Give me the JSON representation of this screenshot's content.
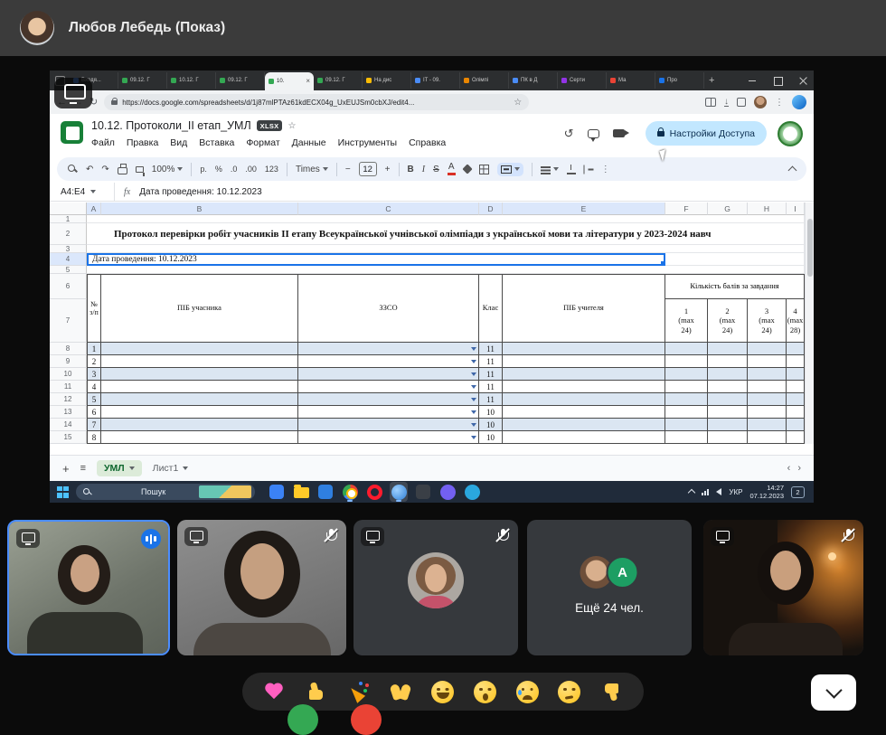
{
  "header": {
    "title": "Любов Лебедь (Показ)"
  },
  "colors": {
    "accent_blue": "#1a73e8",
    "tile_active_border": "#4b8dff",
    "share_pill": "#c2e7ff",
    "sheets_green": "#188038",
    "band_blue": "#dbe6f2"
  },
  "browser": {
    "tabs": [
      {
        "label": "Входя...",
        "favicon": "#4a8cf7"
      },
      {
        "label": "09.12. Г",
        "favicon": "#34a853"
      },
      {
        "label": "10.12. Г",
        "favicon": "#34a853"
      },
      {
        "label": "09.12. Г",
        "favicon": "#34a853"
      },
      {
        "label": "10.",
        "favicon": "#34a853"
      },
      {
        "label": "09.12. Г",
        "favicon": "#34a853"
      },
      {
        "label": "На дис",
        "favicon": "#fbbc05"
      },
      {
        "label": "IT - 09.",
        "favicon": "#4a8cf7"
      },
      {
        "label": "Олімпі",
        "favicon": "#ea8600"
      },
      {
        "label": "ПК в Д",
        "favicon": "#4a8cf7"
      },
      {
        "label": "Серти",
        "favicon": "#9334e6"
      },
      {
        "label": "Ма",
        "favicon": "#ea4335"
      },
      {
        "label": "Про",
        "favicon": "#1a73e8"
      }
    ],
    "close_glyph": "×",
    "new_tab_glyph": "+",
    "url": "https://docs.google.com/spreadsheets/d/1j87mlPTAz61kdECX04g_UxEUJSm0cbXJ/edit4..."
  },
  "sheets": {
    "doc_title": "10.12. Протоколи_ІІ етап_УМЛ",
    "file_badge": "XLSX",
    "menu": [
      "Файл",
      "Правка",
      "Вид",
      "Вставка",
      "Формат",
      "Данные",
      "Инструменты",
      "Справка"
    ],
    "share_label": "Настройки Доступа",
    "toolbar": {
      "zoom": "100%",
      "currency": "р.",
      "percent": "%",
      "dec_down": ".0",
      "dec_up": ".00",
      "plain": "123",
      "font": "Times",
      "size": "12",
      "minus": "−",
      "plus": "+",
      "bold": "B",
      "italic": "I",
      "strike": "S",
      "color": "A",
      "more": "⋮"
    },
    "name_box": "A4:E4",
    "fx": "fx",
    "formula": "Дата проведення: 10.12.2023",
    "columns": [
      "A",
      "B",
      "C",
      "D",
      "E",
      "F",
      "G",
      "H",
      "I"
    ],
    "rows": [
      "1",
      "2",
      "3",
      "4",
      "5",
      "6",
      "7",
      "8",
      "9",
      "10",
      "11",
      "12",
      "13",
      "14",
      "15"
    ],
    "title_text": "Протокол перевірки робіт учасників ІІ етапу Всеукраїнської учнівської олімпіади з української мови та літератури у 2023-2024 навч",
    "date_value": "Дата проведення: 10.12.2023",
    "table_header": {
      "num": "№ з/п",
      "participant": "ПІБ учасника",
      "school": "ЗЗСО",
      "grade": "Клас",
      "teacher": "ПІБ учителя",
      "points": "Кількість балів за завдання",
      "scores": [
        "1\n(max\n24)",
        "2\n(max\n24)",
        "3\n(max\n24)",
        "4\n(max\n28)"
      ]
    },
    "data_rows": [
      {
        "n": "1",
        "grade": "11"
      },
      {
        "n": "2",
        "grade": "11"
      },
      {
        "n": "3",
        "grade": "11"
      },
      {
        "n": "4",
        "grade": "11"
      },
      {
        "n": "5",
        "grade": "11"
      },
      {
        "n": "6",
        "grade": "10"
      },
      {
        "n": "7",
        "grade": "10"
      },
      {
        "n": "8",
        "grade": "10"
      }
    ],
    "sheet_tabs": {
      "add": "+",
      "menu": "≡",
      "active": "УМЛ",
      "other": "Лист1",
      "nav_left": "‹",
      "nav_right": "›"
    }
  },
  "taskbar": {
    "search": "Пошук",
    "lang": "УКР",
    "time": "14:27",
    "date": "07.12.2023",
    "badge": "2"
  },
  "participants": {
    "more": "Ещё 24 чел.",
    "overflow_initial": "A"
  },
  "reactions": [
    "sparkling-heart",
    "thumbs-up",
    "party-popper",
    "clapping-hands",
    "face-with-tears-of-joy",
    "astonished-face",
    "crying-face",
    "thinking-face",
    "thumbs-down"
  ]
}
